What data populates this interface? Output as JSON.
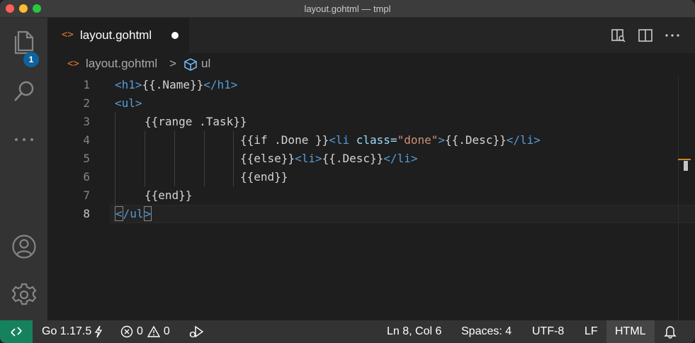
{
  "window": {
    "title": "layout.gohtml — tmpl"
  },
  "activity": {
    "explorer_badge": "1"
  },
  "tab": {
    "label": "layout.gohtml"
  },
  "breadcrumb": {
    "file": "layout.gohtml",
    "separator": ">",
    "symbol": "ul"
  },
  "editor": {
    "line_numbers": [
      "1",
      "2",
      "3",
      "4",
      "5",
      "6",
      "7",
      "8"
    ],
    "lines": {
      "l1": {
        "tag_open": "<h1>",
        "text": "{{.Name}}",
        "tag_close": "</h1>"
      },
      "l2": {
        "tag": "<ul>"
      },
      "l3": {
        "text": "{{range .Task}}"
      },
      "l4": {
        "text1": "{{if .Done }}",
        "tag1": "<li",
        "attr": " class=",
        "str": "\"done\"",
        "tag2": ">",
        "text2": "{{.Desc}}",
        "tag3": "</li>"
      },
      "l5": {
        "text1": "{{else}}",
        "tag1": "<li>",
        "text2": "{{.Desc}}",
        "tag2": "</li>"
      },
      "l6": {
        "text": "{{end}}"
      },
      "l7": {
        "text": "{{end}}"
      },
      "l8": {
        "lt": "<",
        "tag": "/ul",
        "gt": ">"
      }
    }
  },
  "status": {
    "go_version": "Go 1.17.5",
    "errors": "0",
    "warnings": "0",
    "cursor": "Ln 8, Col 6",
    "spaces": "Spaces: 4",
    "encoding": "UTF-8",
    "eol": "LF",
    "language": "HTML"
  }
}
